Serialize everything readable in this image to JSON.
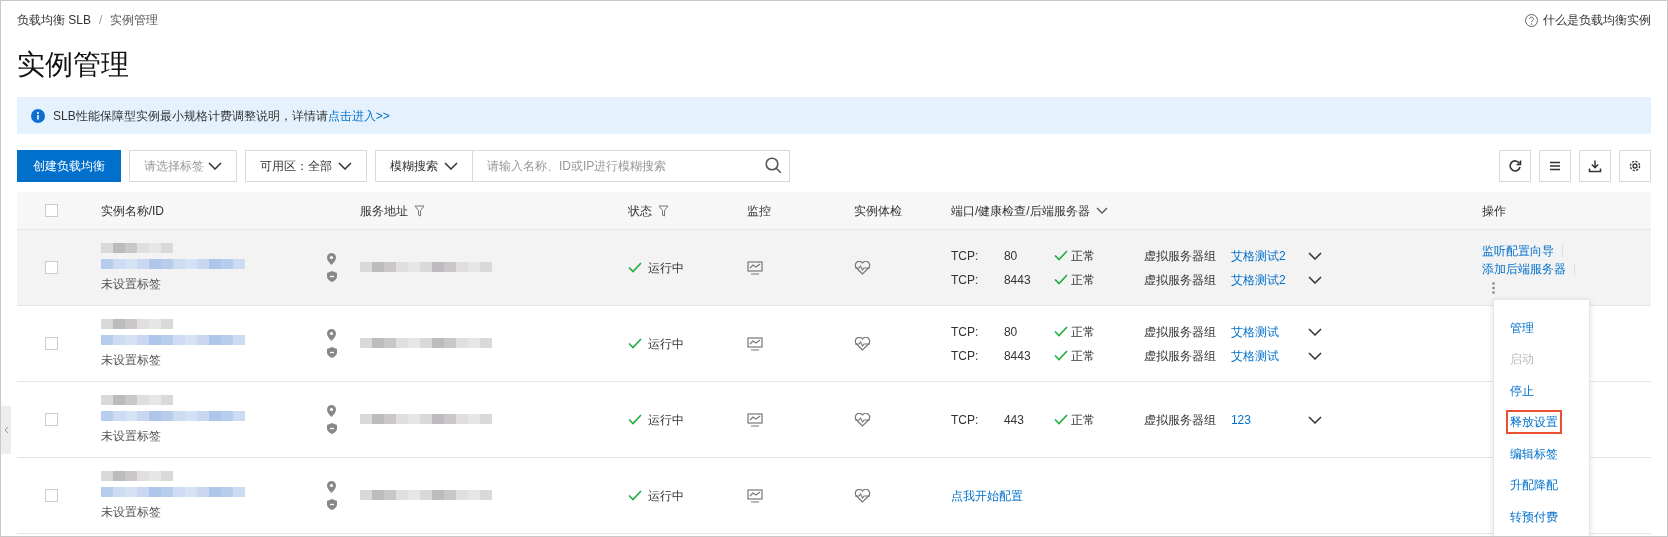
{
  "breadcrumb": [
    "负载均衡 SLB",
    "实例管理"
  ],
  "breadcrumb_separator": "/",
  "help_link": "什么是负载均衡实例",
  "title": "实例管理",
  "notice": {
    "text": "SLB性能保障型实例最小规格计费调整说明，详情请",
    "link": "点击进入>>"
  },
  "toolbar": {
    "create_button": "创建负载均衡",
    "tag_select": {
      "placeholder": "请选择标签"
    },
    "zone_select": "可用区：全部",
    "search_mode": "模糊搜索",
    "search": {
      "placeholder": "请输入名称、ID或IP进行模糊搜索"
    }
  },
  "table": {
    "select_all_checked": false,
    "columns": [
      {
        "label": "实例名称/ID",
        "kind": "plain"
      },
      {
        "label": "服务地址",
        "kind": "filter"
      },
      {
        "label": "状态",
        "kind": "filter"
      },
      {
        "label": "监控",
        "kind": "plain"
      },
      {
        "label": "实例体检",
        "kind": "plain"
      },
      {
        "label": "端口/健康检查/后端服务器",
        "kind": "caret"
      },
      {
        "label": "操作",
        "kind": "plain"
      }
    ],
    "rows": [
      {
        "checked": false,
        "hovered": true,
        "tag": "未设置标签",
        "status": "运行中",
        "listeners": [
          {
            "protocol": "TCP:",
            "port": "80",
            "health": "正常",
            "group_type": "虚拟服务器组",
            "group": "艾格测试2"
          },
          {
            "protocol": "TCP:",
            "port": "8443",
            "health": "正常",
            "group_type": "虚拟服务器组",
            "group": "艾格测试2"
          }
        ],
        "actions": [
          "监听配置向导",
          "添加后端服务器"
        ]
      },
      {
        "checked": false,
        "hovered": false,
        "tag": "未设置标签",
        "status": "运行中",
        "listeners": [
          {
            "protocol": "TCP:",
            "port": "80",
            "health": "正常",
            "group_type": "虚拟服务器组",
            "group": "艾格测试"
          },
          {
            "protocol": "TCP:",
            "port": "8443",
            "health": "正常",
            "group_type": "虚拟服务器组",
            "group": "艾格测试"
          }
        ]
      },
      {
        "checked": false,
        "hovered": false,
        "tag": "未设置标签",
        "status": "运行中",
        "listeners": [
          {
            "protocol": "TCP:",
            "port": "443",
            "health": "正常",
            "group_type": "虚拟服务器组",
            "group": "123"
          }
        ]
      },
      {
        "checked": false,
        "hovered": false,
        "tag": "未设置标签",
        "status": "运行中",
        "config_link": "点我开始配置"
      }
    ]
  },
  "menu": [
    {
      "label": "管理",
      "disabled": false,
      "highlighted": false
    },
    {
      "label": "启动",
      "disabled": true,
      "highlighted": false
    },
    {
      "label": "停止",
      "disabled": false,
      "highlighted": false
    },
    {
      "label": "释放设置",
      "disabled": false,
      "highlighted": true
    },
    {
      "label": "编辑标签",
      "disabled": false,
      "highlighted": false
    },
    {
      "label": "升配降配",
      "disabled": false,
      "highlighted": false
    },
    {
      "label": "转预付费",
      "disabled": false,
      "highlighted": false
    }
  ]
}
